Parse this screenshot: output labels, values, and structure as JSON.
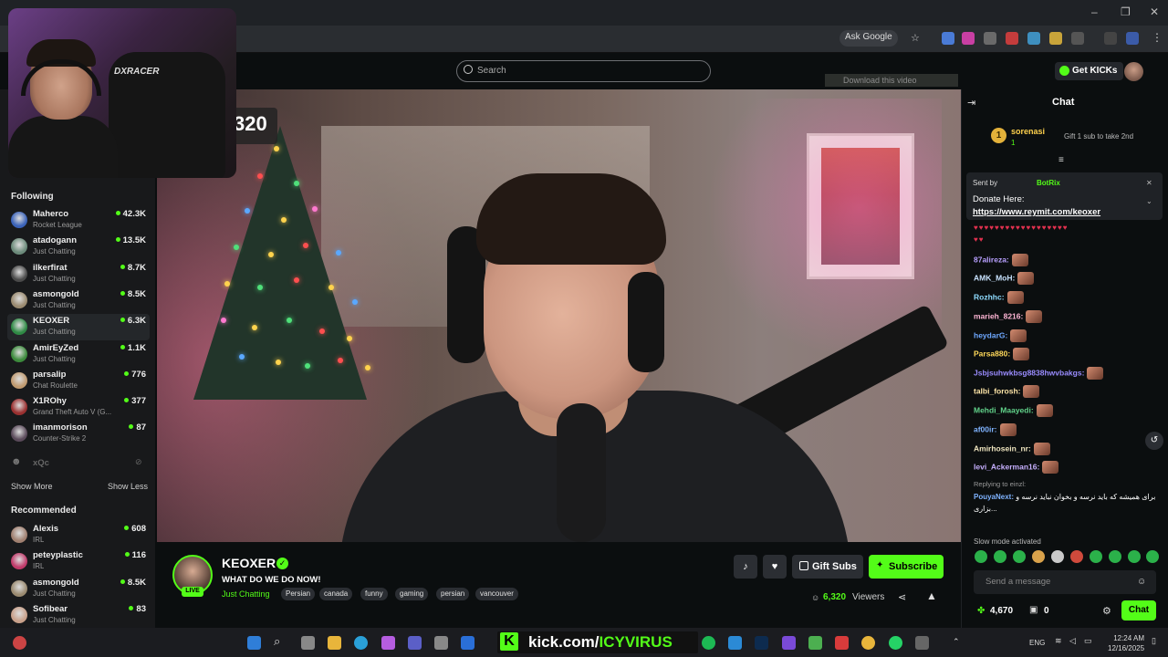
{
  "browser": {
    "ask_google": "Ask Google",
    "minimize": "–",
    "restore": "❐",
    "close": "✕"
  },
  "top": {
    "search_placeholder": "Search",
    "get_kicks": "Get KICKs",
    "download_video": "Download this video"
  },
  "sidebar": {
    "following_title": "Following",
    "following": [
      {
        "name": "Maherco",
        "category": "Rocket League",
        "viewers": "42.3K",
        "color": "#3a62b8"
      },
      {
        "name": "atadogann",
        "category": "Just Chatting",
        "viewers": "13.5K",
        "color": "#6b8a7a"
      },
      {
        "name": "ilkerfirat",
        "category": "Just Chatting",
        "viewers": "8.7K",
        "color": "#4a4a4a"
      },
      {
        "name": "asmongold",
        "category": "Just Chatting",
        "viewers": "8.5K",
        "color": "#9a8a70"
      },
      {
        "name": "KEOXER",
        "category": "Just Chatting",
        "viewers": "6.3K",
        "color": "#2f8a45"
      },
      {
        "name": "AmirEyZed",
        "category": "Just Chatting",
        "viewers": "1.1K",
        "color": "#3c8a3c"
      },
      {
        "name": "parsalip",
        "category": "Chat Roulette",
        "viewers": "776",
        "color": "#c09a70"
      },
      {
        "name": "X1ROhy",
        "category": "Grand Theft Auto V (G...",
        "viewers": "377",
        "color": "#9a3030"
      },
      {
        "name": "imanmorison",
        "category": "Counter-Strike 2",
        "viewers": "87",
        "color": "#5a4a5a"
      }
    ],
    "offline_name": "xQc",
    "show_more": "Show More",
    "show_less": "Show Less",
    "recommended_title": "Recommended",
    "recommended": [
      {
        "name": "Alexis",
        "category": "IRL",
        "viewers": "608",
        "color": "#a08070"
      },
      {
        "name": "peteyplastic",
        "category": "IRL",
        "viewers": "116",
        "color": "#c03a6a"
      },
      {
        "name": "asmongold",
        "category": "Just Chatting",
        "viewers": "8.5K",
        "color": "#9a8a70"
      },
      {
        "name": "Sofibear",
        "category": "Just Chatting",
        "viewers": "83",
        "color": "#c8a08a"
      }
    ]
  },
  "video": {
    "counter": "320"
  },
  "webcam": {
    "chair_logo": "DXRACER"
  },
  "stream": {
    "channel": "KEOXER",
    "live": "LIVE",
    "title": "WHAT DO WE DO NOW!",
    "category": "Just Chatting",
    "tags": [
      "Persian",
      "canada",
      "funny",
      "gaming",
      "persian",
      "vancouver"
    ],
    "gift_subs": "Gift Subs",
    "subscribe": "Subscribe",
    "viewer_count": "6,320",
    "viewers_label": "Viewers"
  },
  "chat": {
    "title": "Chat",
    "top_gifter": {
      "rank": "1",
      "user": "sorenasi",
      "count": "1",
      "cta": "Gift 1 sub to take 2nd"
    },
    "pinned": {
      "sent_by": "Sent by",
      "bot": "BotRix",
      "line1": "Donate Here:",
      "link": "https://www.reymit.com/keoxer"
    },
    "hearts_row1": "♥♥♥♥♥♥♥♥♥♥♥♥♥♥♥♥♥♥",
    "hearts_row2": "♥♥",
    "messages": [
      {
        "user": "87alireza:",
        "color": "#b8a0ff"
      },
      {
        "user": "AMK_MoH:",
        "color": "#c9e3ff"
      },
      {
        "user": "Rozhhc:",
        "color": "#8fdcff"
      },
      {
        "user": "marieh_8216:",
        "color": "#ffb6d5"
      },
      {
        "user": "heydarG:",
        "color": "#6ea8ff"
      },
      {
        "user": "Parsa880:",
        "color": "#ffd95a"
      },
      {
        "user": "Jsbjsuhwkbsg8838hwvbakgs:",
        "color": "#9a8cff"
      },
      {
        "user": "talbi_forosh:",
        "color": "#ffe6a8"
      },
      {
        "user": "Mehdi_Maayedi:",
        "color": "#62d48b"
      },
      {
        "user": "af00ir:",
        "color": "#7fb3ff"
      },
      {
        "user": "Amirhosein_nr:",
        "color": "#f0e6c0"
      },
      {
        "user": "levi_Ackerman16:",
        "color": "#c7b0ff"
      }
    ],
    "reply_context": "Replying to einzl:",
    "reply_user": "PouyaNext:",
    "reply_text": "برای همیشه که باید نرسه و بخوان نباید نرسه و بزاری...",
    "slow_mode": "Slow mode activated",
    "send_placeholder": "Send a message",
    "kicks_balance": "4,670",
    "chest_count": "0",
    "chat_button": "Chat"
  },
  "taskbar": {
    "banner_prefix": "kick.com/",
    "banner_highlight": "ICYVIRUS",
    "lang": "ENG",
    "time": "12:24 AM",
    "date": "12/16/2025"
  }
}
